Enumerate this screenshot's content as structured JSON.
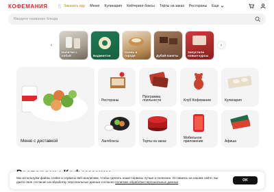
{
  "header": {
    "logo": "КОФЕМАНИЯ",
    "nav": [
      {
        "label": "Заказать еду",
        "type": "order"
      },
      {
        "label": "Меню"
      },
      {
        "label": "Кулинария"
      },
      {
        "label": "Кейтеринг-боксы"
      },
      {
        "label": "Торты на заказ"
      },
      {
        "label": "Рестораны"
      },
      {
        "label": "Еще"
      }
    ]
  },
  "search": {
    "placeholder": "Введите название блюда"
  },
  "stories": [
    {
      "label": "Напитки с собой"
    },
    {
      "label": "Бадминтон"
    },
    {
      "label": "Осень в городе"
    },
    {
      "label": "Дубай-панеты"
    },
    {
      "label": "Запустили новые курсы"
    }
  ],
  "tiles": {
    "main": {
      "label": "Меню с доставкой"
    },
    "restaurants": {
      "label": "Рестораны"
    },
    "loyalty": {
      "label": "Программа лояльности"
    },
    "club": {
      "label": "Клуб Кофемании"
    },
    "culinary": {
      "label": "Кулинария"
    },
    "lunchboxes": {
      "label": "Ланчбоксы"
    },
    "cakes": {
      "label": "Торты на заказ"
    },
    "mobile": {
      "label": "Мобильное приложение"
    },
    "poster": {
      "label": "Афиша"
    }
  },
  "section_title": "Рестораны Кофемании",
  "cookie": {
    "text": "Мы используем файлы cookie и сервисы веб-аналитики, чтобы сделать наши сервисы лучше и полезнее. Оставаясь на нашем сайте, вы даете свое согласие на обработку персональных данных согласно ",
    "link": "политике обработки персональных данных",
    "button": "OK"
  },
  "colors": {
    "brand": "#e3262b",
    "accent": "#b8860b",
    "tile_bg": "#f4f4f4"
  }
}
